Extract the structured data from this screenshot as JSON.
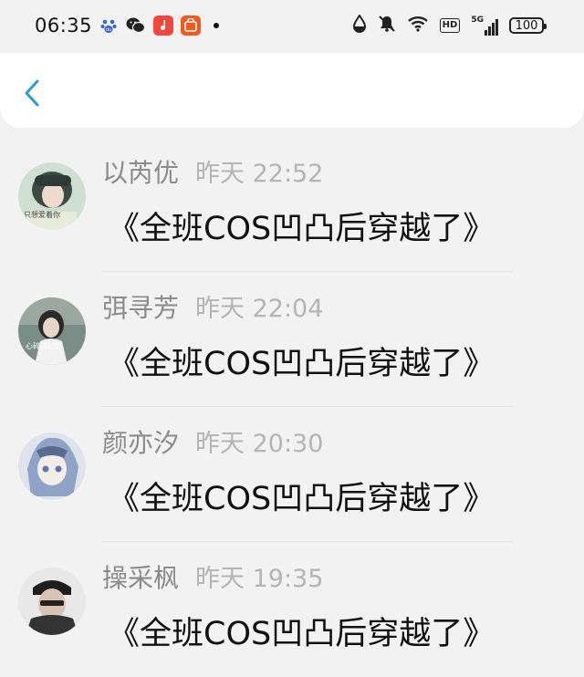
{
  "status_bar": {
    "time": "06:35",
    "battery": "100",
    "network": "5G",
    "hd_label": "HD",
    "app_icons": [
      "baidu-icon",
      "wechat-icon",
      "music-icon",
      "shopping-icon"
    ]
  },
  "header": {
    "back_icon": "chevron-left-icon"
  },
  "comments": [
    {
      "name": "以芮优",
      "time": "昨天 22:52",
      "message": "《全班COS凹凸后穿越了》",
      "avatar_text": "只想爱着你"
    },
    {
      "name": "弭寻芳",
      "time": "昨天 22:04",
      "message": "《全班COS凹凸后穿越了》",
      "avatar_text": "心碎的记忆"
    },
    {
      "name": "颜亦汐",
      "time": "昨天 20:30",
      "message": "《全班COS凹凸后穿越了》",
      "avatar_text": ""
    },
    {
      "name": "操采枫",
      "time": "昨天 19:35",
      "message": "《全班COS凹凸后穿越了》",
      "avatar_text": ""
    }
  ],
  "colors": {
    "accent": "#2a9bd8",
    "name_text": "#8a8a8a",
    "time_text": "#b4b4b4",
    "background": "#f2f2f2"
  }
}
